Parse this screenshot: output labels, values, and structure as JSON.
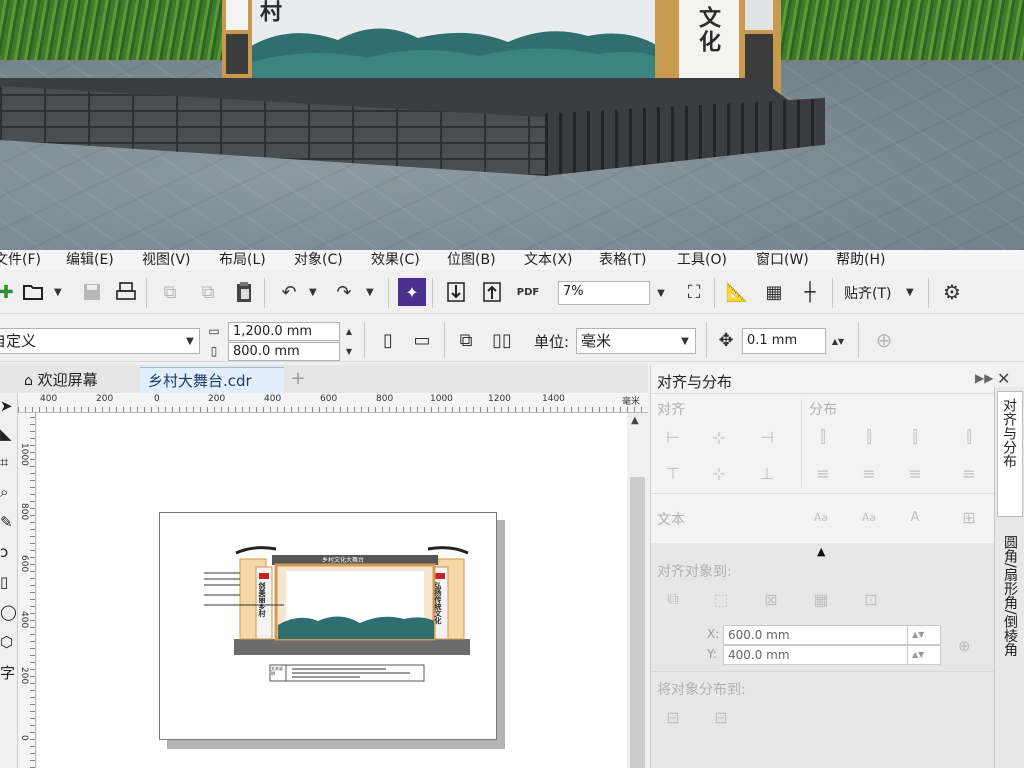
{
  "scene": {
    "left_sign_text": "村",
    "right_sign_text": "文化",
    "colors": {
      "grass": "#4f8c33",
      "road": "#7d8b92",
      "platform": "#3b3d40",
      "frame": "#c99a4e",
      "mountain": "#2f6f6f"
    }
  },
  "menu": [
    "文件(F)",
    "编辑(E)",
    "视图(V)",
    "布局(L)",
    "对象(C)",
    "效果(C)",
    "位图(B)",
    "文本(X)",
    "表格(T)",
    "工具(O)",
    "窗口(W)",
    "帮助(H)"
  ],
  "toolbar1": {
    "zoom_value": "7%",
    "snap_label": "贴齐(T)"
  },
  "toolbar2": {
    "page_preset": "自定义",
    "width_value": "1,200.0 mm",
    "height_value": "800.0 mm",
    "units_label": "单位:",
    "units_value": "毫米",
    "nudge_value": "0.1 mm"
  },
  "doc_tabs": [
    {
      "label": "欢迎屏幕"
    },
    {
      "label": "乡村大舞台.cdr"
    }
  ],
  "rulers": {
    "h": [
      "400",
      "200",
      "0",
      "200",
      "400",
      "600",
      "800",
      "1000",
      "1200",
      "1400"
    ],
    "unit": "毫米",
    "v": [
      "1000",
      "800",
      "600",
      "400",
      "200",
      "0"
    ]
  },
  "drawing": {
    "banner_text": "乡村文化大舞台",
    "left_sign_text": "剑美丽乡村",
    "right_sign_text": "弘扬传统文化",
    "caption_label": "文本说明"
  },
  "docker": {
    "title": "对齐与分布",
    "sections": {
      "align": "对齐",
      "distribute": "分布",
      "text": "文本",
      "align_to": "对齐对象到:",
      "distribute_to": "将对象分布到:"
    },
    "x_label": "X:",
    "x_value": "600.0 mm",
    "y_label": "Y:",
    "y_value": "400.0 mm"
  },
  "docker_tabs": [
    {
      "label": "对齐与分布"
    },
    {
      "label": "圆角/扇形角/倒棱角"
    }
  ],
  "accent_color": "#2d6db5",
  "icons": [
    "new-icon",
    "open-icon",
    "save-icon",
    "print-icon",
    "import-icon",
    "export-icon",
    "publish-pdf-icon",
    "undo-icon",
    "redo-icon",
    "full-screen-icon",
    "rulers-icon",
    "grid-icon",
    "guidelines-icon",
    "settings-icon",
    "portrait-icon",
    "landscape-icon",
    "all-pages-icon",
    "current-page-icon",
    "nudge-icon",
    "add-preset-icon",
    "home-icon",
    "add-tab-icon"
  ]
}
